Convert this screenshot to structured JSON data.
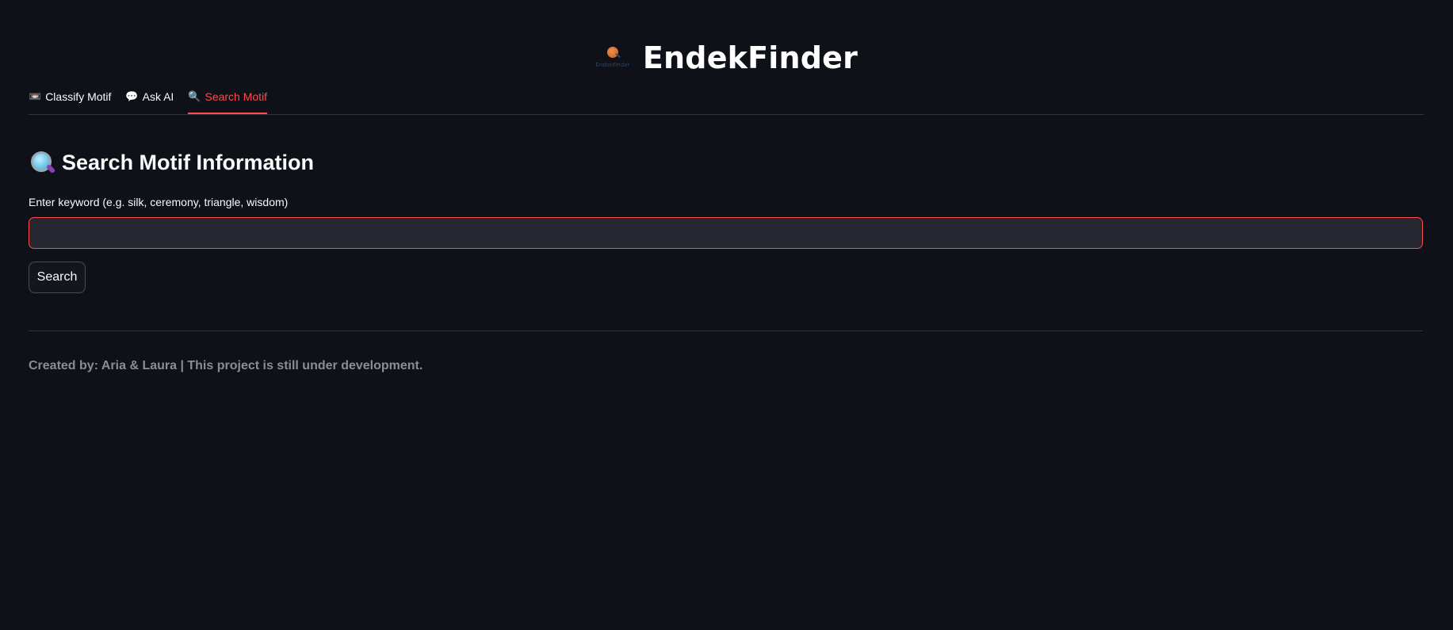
{
  "header": {
    "logo_caption": "EndekFinder",
    "title": "EndekFinder"
  },
  "tabs": [
    {
      "icon": "📼",
      "icon_name": "videocassette-icon",
      "label": "Classify Motif",
      "active": false
    },
    {
      "icon": "💬",
      "icon_name": "speech-bubble-icon",
      "label": "Ask AI",
      "active": false
    },
    {
      "icon": "🔍",
      "icon_name": "magnifier-icon",
      "label": "Search Motif",
      "active": true
    }
  ],
  "section": {
    "icon_name": "magnifier-icon",
    "title": "Search Motif Information"
  },
  "search": {
    "label": "Enter keyword (e.g. silk, ceremony, triangle, wisdom)",
    "value": "",
    "placeholder": "",
    "button_label": "Search"
  },
  "footer": {
    "text": "Created by: Aria & Laura | This project is still under development."
  },
  "colors": {
    "background": "#0e1117",
    "accent": "#ff4b4b",
    "input_background": "#262730",
    "muted_text": "#8b8d95"
  }
}
